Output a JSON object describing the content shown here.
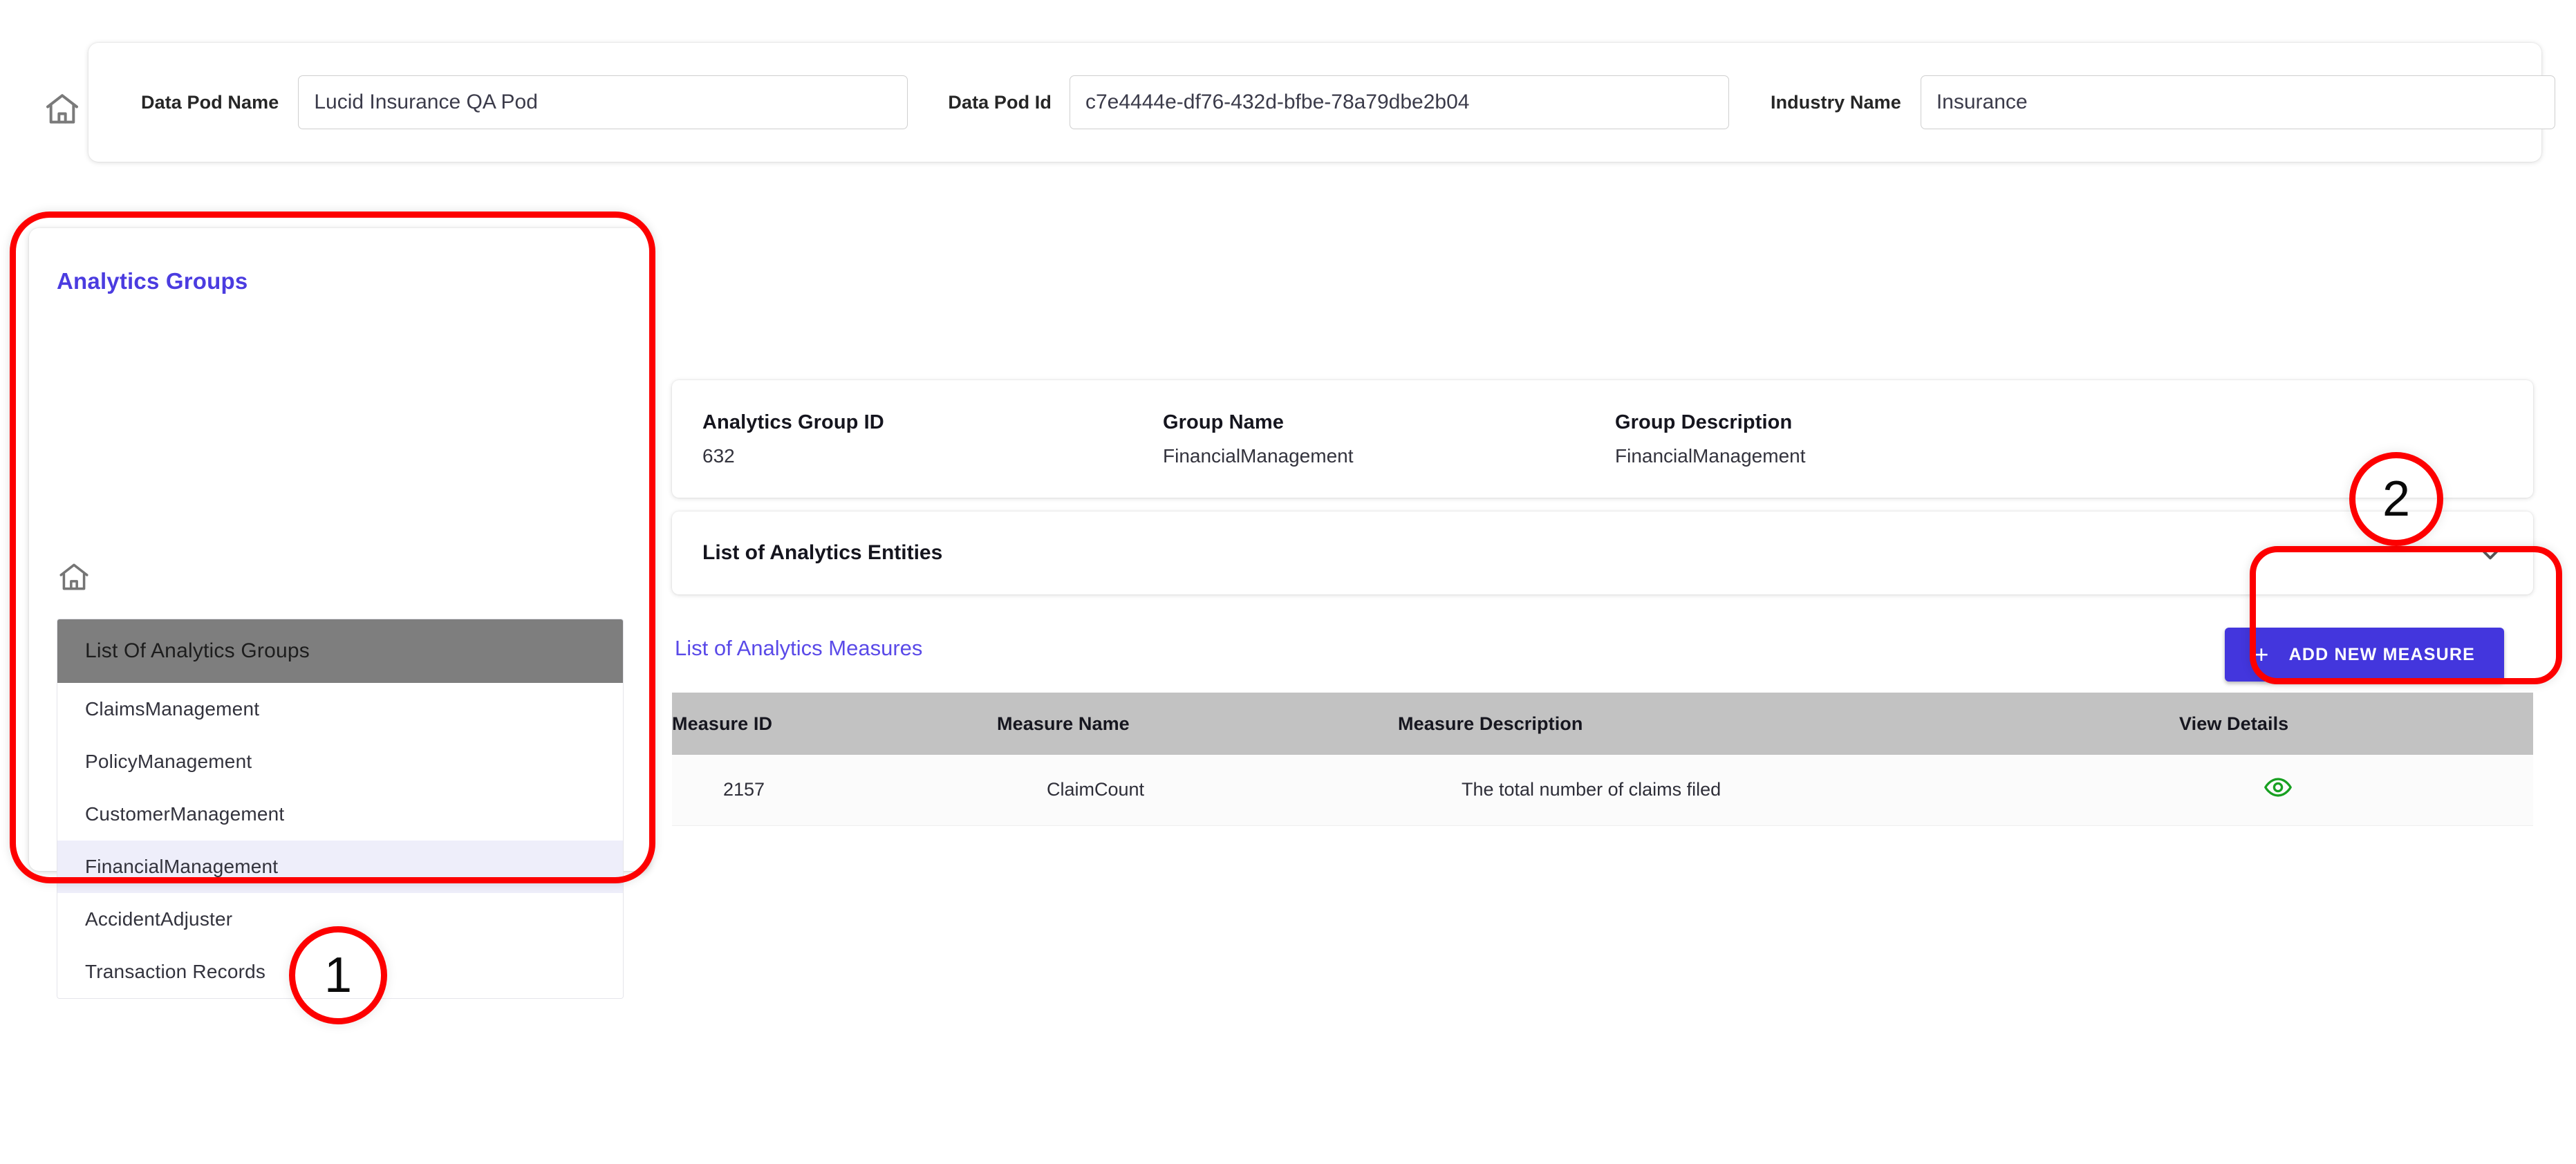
{
  "topbar": {
    "home_icon": "home-icon",
    "fields": [
      {
        "label": "Data Pod Name",
        "value": "Lucid Insurance QA Pod"
      },
      {
        "label": "Data Pod Id",
        "value": "c7e4444e-df76-432d-bfbe-78a79dbe2b04"
      },
      {
        "label": "Industry Name",
        "value": "Insurance"
      }
    ]
  },
  "sidebar": {
    "title": "Analytics Groups",
    "home_icon": "home-icon",
    "list_header": "List Of Analytics Groups",
    "items": [
      {
        "label": "ClaimsManagement",
        "selected": false
      },
      {
        "label": "PolicyManagement",
        "selected": false
      },
      {
        "label": "CustomerManagement",
        "selected": false
      },
      {
        "label": "FinancialManagement",
        "selected": true
      },
      {
        "label": "AccidentAdjuster",
        "selected": false
      },
      {
        "label": "Transaction Records",
        "selected": false
      }
    ]
  },
  "main": {
    "group_summary": {
      "id_label": "Analytics Group ID",
      "id_value": "632",
      "name_label": "Group Name",
      "name_value": "FinancialManagement",
      "desc_label": "Group Description",
      "desc_value": "FinancialManagement"
    },
    "entities_section": {
      "title": "List of Analytics Entities",
      "toggle_icon": "chevron-down-icon"
    },
    "measures_section": {
      "link_label": "List of Analytics Measures",
      "add_button_label": "ADD NEW MEASURE",
      "add_button_icon": "plus-icon",
      "columns": [
        "Measure ID",
        "Measure Name",
        "Measure Description",
        "View Details"
      ],
      "rows": [
        {
          "measure_id": "2157",
          "measure_name": "ClaimCount",
          "measure_description": "The total number of claims filed",
          "view_details_icon": "eye-icon"
        }
      ]
    }
  },
  "annotations": [
    {
      "id": "1",
      "label": "1"
    },
    {
      "id": "2",
      "label": "2"
    }
  ],
  "colors": {
    "accent_purple": "#4b3ce0",
    "button_purple": "#4336dd",
    "annotation_red": "#fd0000",
    "header_gray": "#c2c2c2",
    "list_header_gray": "#7e7e7e",
    "selected_row": "#eeeefa",
    "eye_green": "#18a021"
  }
}
